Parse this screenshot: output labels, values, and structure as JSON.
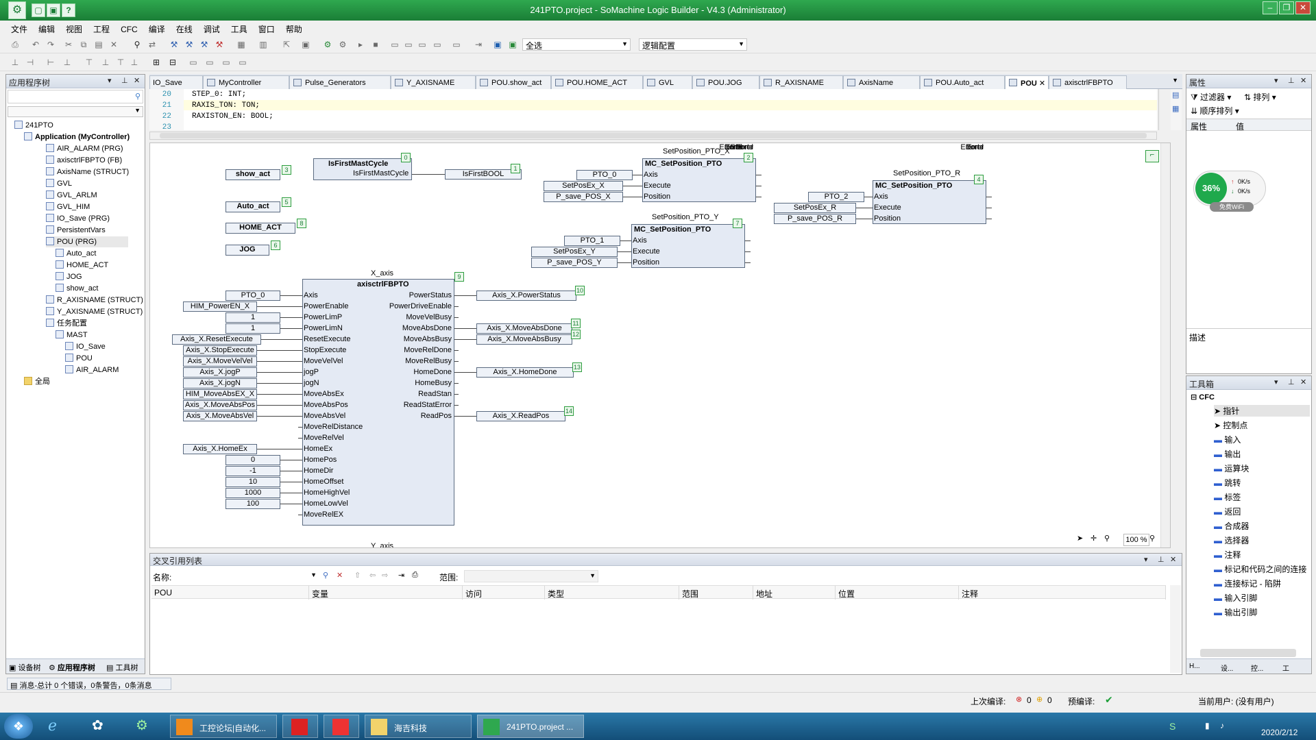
{
  "window": {
    "title": "241PTO.project - SoMachine Logic Builder - V4.3 (Administrator)"
  },
  "menu": [
    "文件",
    "编辑",
    "视图",
    "工程",
    "CFC",
    "编译",
    "在线",
    "调试",
    "工具",
    "窗口",
    "帮助"
  ],
  "toolbar": {
    "select_all": "全选",
    "logic_config": "逻辑配置"
  },
  "app_tree": {
    "title": "应用程序树",
    "items": [
      {
        "label": "241PTO",
        "indent": 0
      },
      {
        "label": "Application (MyController)",
        "indent": 1
      },
      {
        "label": "AIR_ALARM (PRG)",
        "indent": 2
      },
      {
        "label": "axisctrlFBPTO (FB)",
        "indent": 2
      },
      {
        "label": "AxisName (STRUCT)",
        "indent": 2
      },
      {
        "label": "GVL",
        "indent": 2
      },
      {
        "label": "GVL_ARLM",
        "indent": 2
      },
      {
        "label": "GVL_HIM",
        "indent": 2
      },
      {
        "label": "IO_Save (PRG)",
        "indent": 2
      },
      {
        "label": "PersistentVars",
        "indent": 2
      },
      {
        "label": "POU (PRG)",
        "indent": 2
      },
      {
        "label": "Auto_act",
        "indent": 3
      },
      {
        "label": "HOME_ACT",
        "indent": 3
      },
      {
        "label": "JOG",
        "indent": 3
      },
      {
        "label": "show_act",
        "indent": 3
      },
      {
        "label": "R_AXISNAME (STRUCT)",
        "indent": 2
      },
      {
        "label": "Y_AXISNAME (STRUCT)",
        "indent": 2
      },
      {
        "label": "任务配置",
        "indent": 2
      },
      {
        "label": "MAST",
        "indent": 3
      },
      {
        "label": "IO_Save",
        "indent": 4
      },
      {
        "label": "POU",
        "indent": 4
      },
      {
        "label": "AIR_ALARM",
        "indent": 4
      },
      {
        "label": "全局",
        "indent": 1
      }
    ],
    "bottom_tabs": [
      "设备树",
      "应用程序树",
      "工具树"
    ]
  },
  "editor_tabs": [
    "IO_Save",
    "MyController",
    "Pulse_Generators",
    "Y_AXISNAME",
    "POU.show_act",
    "POU.HOME_ACT",
    "GVL",
    "POU.JOG",
    "R_AXISNAME",
    "AxisName",
    "POU.Auto_act",
    "POU",
    "axisctrlFBPTO"
  ],
  "code_lines": [
    {
      "n": "20",
      "t": "STEP_0: INT;"
    },
    {
      "n": "21",
      "t": "RAXIS_TON: TON;"
    },
    {
      "n": "22",
      "t": "RAXISTON_EN: BOOL;"
    },
    {
      "n": "23",
      "t": ""
    }
  ],
  "cfc": {
    "actions": [
      {
        "label": "show_act",
        "num": "3"
      },
      {
        "label": "Auto_act",
        "num": "5"
      },
      {
        "label": "HOME_ACT",
        "num": "8"
      },
      {
        "label": "JOG",
        "num": "6"
      }
    ],
    "first_cycle": {
      "name": "IsFirstMastCycle",
      "output": "IsFirstMastCycle",
      "num": "0",
      "out_var": "IsFirstBOOL",
      "out_num": "1"
    },
    "set_pos_x": {
      "instance": "SetPosition_PTO_X",
      "type": "MC_SetPosition_PTO",
      "num": "2",
      "inputs": [
        "PTO_0",
        "SetPosEx_X",
        "P_save_POS_X"
      ]
    },
    "set_pos_y": {
      "instance": "SetPosition_PTO_Y",
      "type": "MC_SetPosition_PTO",
      "num": "7",
      "inputs": [
        "PTO_1",
        "SetPosEx_Y",
        "P_save_POS_Y"
      ]
    },
    "set_pos_r": {
      "instance": "SetPosition_PTO_R",
      "type": "MC_SetPosition_PTO",
      "num": "4",
      "inputs": [
        "PTO_2",
        "SetPosEx_R",
        "P_save_POS_R"
      ]
    },
    "setpos_in_pins": [
      "Axis",
      "Execute",
      "Position"
    ],
    "setpos_out_pins": [
      "Done",
      "Error",
      "ErrorId"
    ],
    "axis_fb": {
      "instance": "X_axis",
      "type": "axisctrlFBPTO",
      "num": "9",
      "in_pins": [
        "Axis",
        "PowerEnable",
        "PowerLimP",
        "PowerLimN",
        "ResetExecute",
        "StopExecute",
        "MoveVelVel",
        "jogP",
        "jogN",
        "MoveAbsEx",
        "MoveAbsPos",
        "MoveAbsVel",
        "MoveRelDistance",
        "MoveRelVel",
        "HomeEx",
        "HomePos",
        "HomeDir",
        "HomeOffset",
        "HomeHighVel",
        "HomeLowVel",
        "MoveRelEX"
      ],
      "out_pins": [
        "PowerStatus",
        "PowerDriveEnable",
        "MoveVelBusy",
        "MoveAbsDone",
        "MoveAbsBusy",
        "MoveRelDone",
        "MoveRelBusy",
        "HomeDone",
        "HomeBusy",
        "ReadStan",
        "ReadStatError",
        "ReadPos"
      ],
      "in_vars": [
        {
          "pin": 0,
          "v": "PTO_0"
        },
        {
          "pin": 1,
          "v": "HIM_PowerEN_X"
        },
        {
          "pin": 2,
          "v": "1"
        },
        {
          "pin": 3,
          "v": "1"
        },
        {
          "pin": 4,
          "v": "Axis_X.ResetExecute"
        },
        {
          "pin": 5,
          "v": "Axis_X.StopExecute"
        },
        {
          "pin": 6,
          "v": "Axis_X.MoveVelVel"
        },
        {
          "pin": 7,
          "v": "Axis_X.jogP"
        },
        {
          "pin": 8,
          "v": "Axis_X.jogN"
        },
        {
          "pin": 9,
          "v": "HIM_MoveAbsEX_X"
        },
        {
          "pin": 10,
          "v": "Axis_X.MoveAbsPos"
        },
        {
          "pin": 11,
          "v": "Axis_X.MoveAbsVel"
        },
        {
          "pin": 14,
          "v": "Axis_X.HomeEx"
        },
        {
          "pin": 15,
          "v": "0"
        },
        {
          "pin": 16,
          "v": "-1"
        },
        {
          "pin": 17,
          "v": "10"
        },
        {
          "pin": 18,
          "v": "1000"
        },
        {
          "pin": 19,
          "v": "100"
        }
      ],
      "out_vars": [
        {
          "pin": 0,
          "v": "Axis_X.PowerStatus",
          "num": "10"
        },
        {
          "pin": 3,
          "v": "Axis_X.MoveAbsDone",
          "num": "11"
        },
        {
          "pin": 4,
          "v": "Axis_X.MoveAbsBusy",
          "num": "12"
        },
        {
          "pin": 7,
          "v": "Axis_X.HomeDone",
          "num": "13"
        },
        {
          "pin": 11,
          "v": "Axis_X.ReadPos",
          "num": "14"
        }
      ]
    },
    "next_instance": "Y_axis",
    "zoom": "100 %"
  },
  "xref": {
    "title": "交叉引用列表",
    "name_label": "名称:",
    "scope_label": "范围:",
    "columns": [
      "POU",
      "变量",
      "访问",
      "类型",
      "范围",
      "地址",
      "位置",
      "注释"
    ]
  },
  "props": {
    "title": "属性",
    "filter": "过滤器",
    "sort": "排列",
    "order": "顺序排列",
    "col1": "属性",
    "col2": "值",
    "desc": "描述"
  },
  "net_widget": {
    "percent": "36%",
    "up": "0K/s",
    "down": "0K/s",
    "wifi": "免费WiFi"
  },
  "toolbox": {
    "title": "工具箱",
    "category": "CFC",
    "items": [
      "指针",
      "控制点",
      "输入",
      "输出",
      "运算块",
      "跳转",
      "标签",
      "返回",
      "合成器",
      "选择器",
      "注释",
      "标记和代码之间的连接",
      "连接标记 - 陷阱",
      "输入引脚",
      "输出引脚"
    ],
    "bottom_tabs": [
      "H...",
      "设...",
      "控...",
      "工"
    ]
  },
  "status": {
    "message": "消息-总计 0 个错误，0条警告，0条消息",
    "last_compile": "上次编译:",
    "err_count": "0",
    "warn_count": "0",
    "precompile": "预编译:",
    "user": "当前用户: (没有用户)"
  },
  "taskbar": {
    "tasks": [
      "工控论坛|自动化...",
      "",
      "",
      "海吉科技",
      "241PTO.project ..."
    ],
    "date": "2020/2/12"
  }
}
